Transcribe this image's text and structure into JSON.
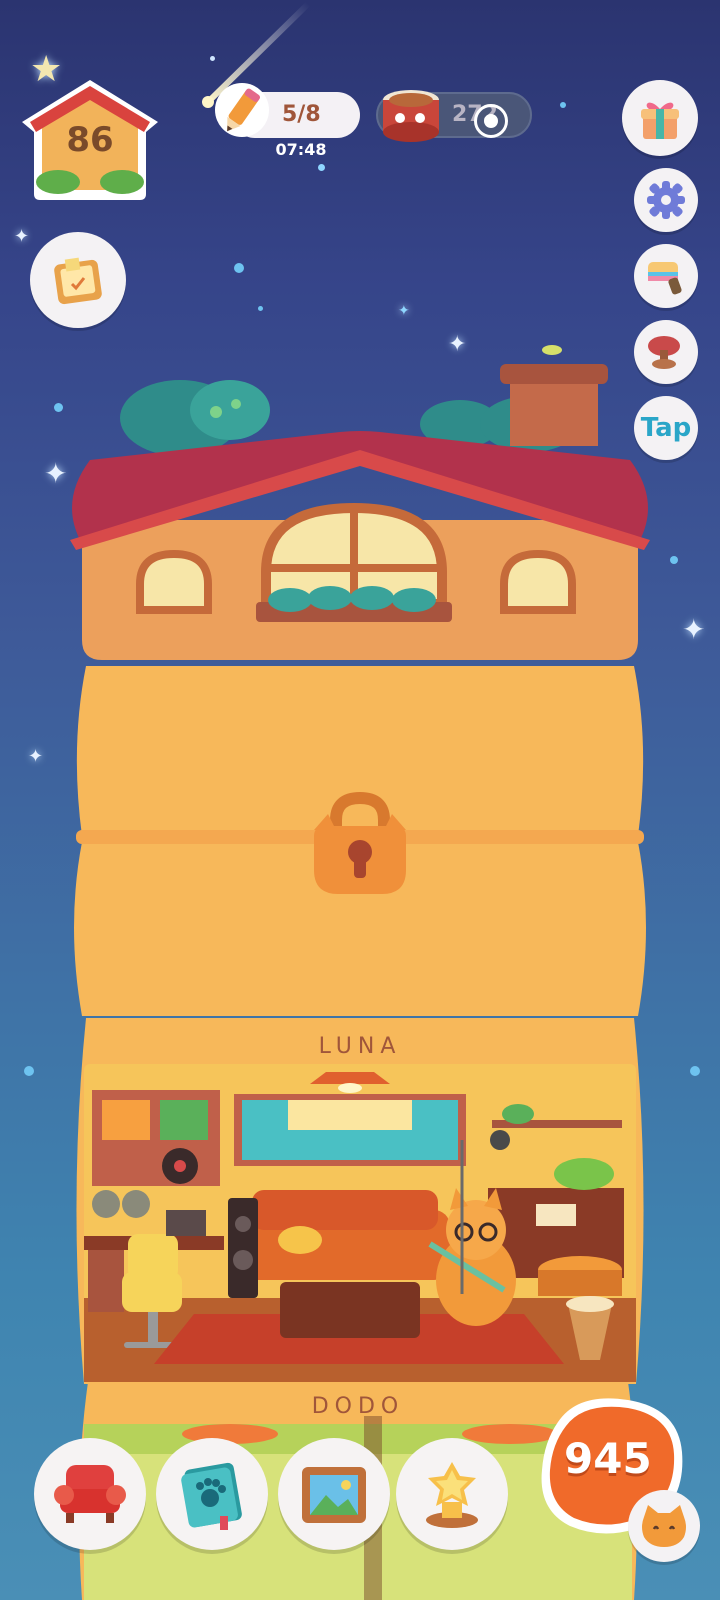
{
  "hud": {
    "house_level": "86",
    "pencil_counter": "5/8",
    "pencil_timer": "07:48",
    "can_count": "272"
  },
  "side_buttons": {
    "tap_label": "Tap"
  },
  "floors": {
    "luna_label": "LUNA",
    "dodo_label": "DODO"
  },
  "bottom": {
    "coin_count": "945"
  },
  "icons": {
    "house_badge": "house-icon",
    "pencil": "pencil-icon",
    "cat_food_can": "cat-food-can-icon",
    "record": "record-icon",
    "gift": "gift-icon",
    "settings": "gear-icon",
    "paint": "paint-roller-icon",
    "stamp": "stamp-icon",
    "task_board": "task-board-icon",
    "lock": "padlock-icon",
    "furniture": "armchair-icon",
    "catbook": "paw-book-icon",
    "album": "photo-frame-icon",
    "trophy": "trophy-icon",
    "cat": "cat-face-icon"
  },
  "colors": {
    "sky_top": "#2b3470",
    "sky_bottom": "#4a8fb6",
    "tower": "#f5b85a",
    "roof": "#b8324a",
    "coin_badge": "#f06a2a",
    "tap_text": "#2aa6c8"
  }
}
